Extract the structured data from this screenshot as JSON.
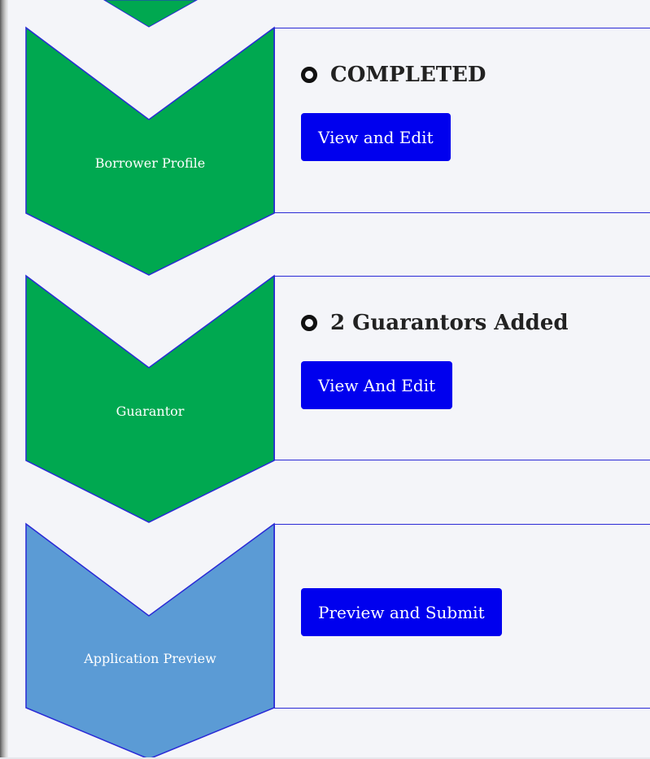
{
  "steps": [
    {
      "label": "Borrower Profile",
      "status": "COMPLETED",
      "button": "View and Edit",
      "color": "#00a850"
    },
    {
      "label": "Guarantor",
      "status": "2 Guarantors Added",
      "button": "View And Edit",
      "color": "#00a850"
    },
    {
      "label": "Application Preview",
      "status": "",
      "button": "Preview and Submit",
      "color": "#5b9bd5"
    }
  ],
  "colors": {
    "completed": "#00a850",
    "pending": "#5b9bd5",
    "button": "#0000ee",
    "border": "#2a2ad6",
    "background": "#f4f5f9"
  }
}
